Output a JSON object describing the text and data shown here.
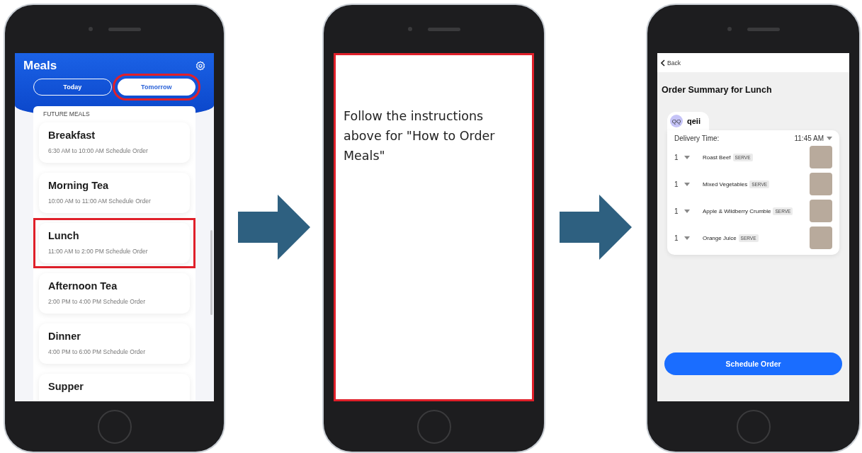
{
  "phones": [
    {
      "kind": "meals",
      "title": "Meals",
      "tabs": [
        {
          "label": "Today",
          "selected": false,
          "highlighted": false
        },
        {
          "label": "Tomorrow",
          "selected": true,
          "highlighted": true
        }
      ],
      "section_label": "FUTURE MEALS",
      "meals": [
        {
          "name": "Breakfast",
          "times": "6:30 AM to 10:00 AM Schedule Order",
          "highlighted": false
        },
        {
          "name": "Morning Tea",
          "times": "10:00 AM to 11:00 AM Schedule Order",
          "highlighted": false
        },
        {
          "name": "Lunch",
          "times": "11:00 AM to 2:00 PM Schedule Order",
          "highlighted": true
        },
        {
          "name": "Afternoon Tea",
          "times": "2:00 PM to 4:00 PM Schedule Order",
          "highlighted": false
        },
        {
          "name": "Dinner",
          "times": "4:00 PM to 6:00 PM Schedule Order",
          "highlighted": false
        },
        {
          "name": "Supper",
          "highlighted": false
        }
      ]
    },
    {
      "kind": "instruction",
      "text": "Follow the instructions above for \"How to Order Meals\"",
      "highlighted": true
    },
    {
      "kind": "order",
      "back_label": "Back",
      "title": "Order Summary for Lunch",
      "diner": {
        "initials": "QQ",
        "name": "qeii"
      },
      "delivery_label": "Delivery Time:",
      "delivery_time": "11:45 AM",
      "items": [
        {
          "quantity": "1",
          "name": "Roast Beef",
          "tag": "SERVE"
        },
        {
          "quantity": "1",
          "name": "Mixed Vegetables",
          "tag": "SERVE"
        },
        {
          "quantity": "1",
          "name": "Apple & Wildberry Crumble",
          "tag": "SERVE"
        },
        {
          "quantity": "1",
          "name": "Orange Juice",
          "tag": "SERVE"
        }
      ],
      "button": "Schedule Order"
    }
  ]
}
